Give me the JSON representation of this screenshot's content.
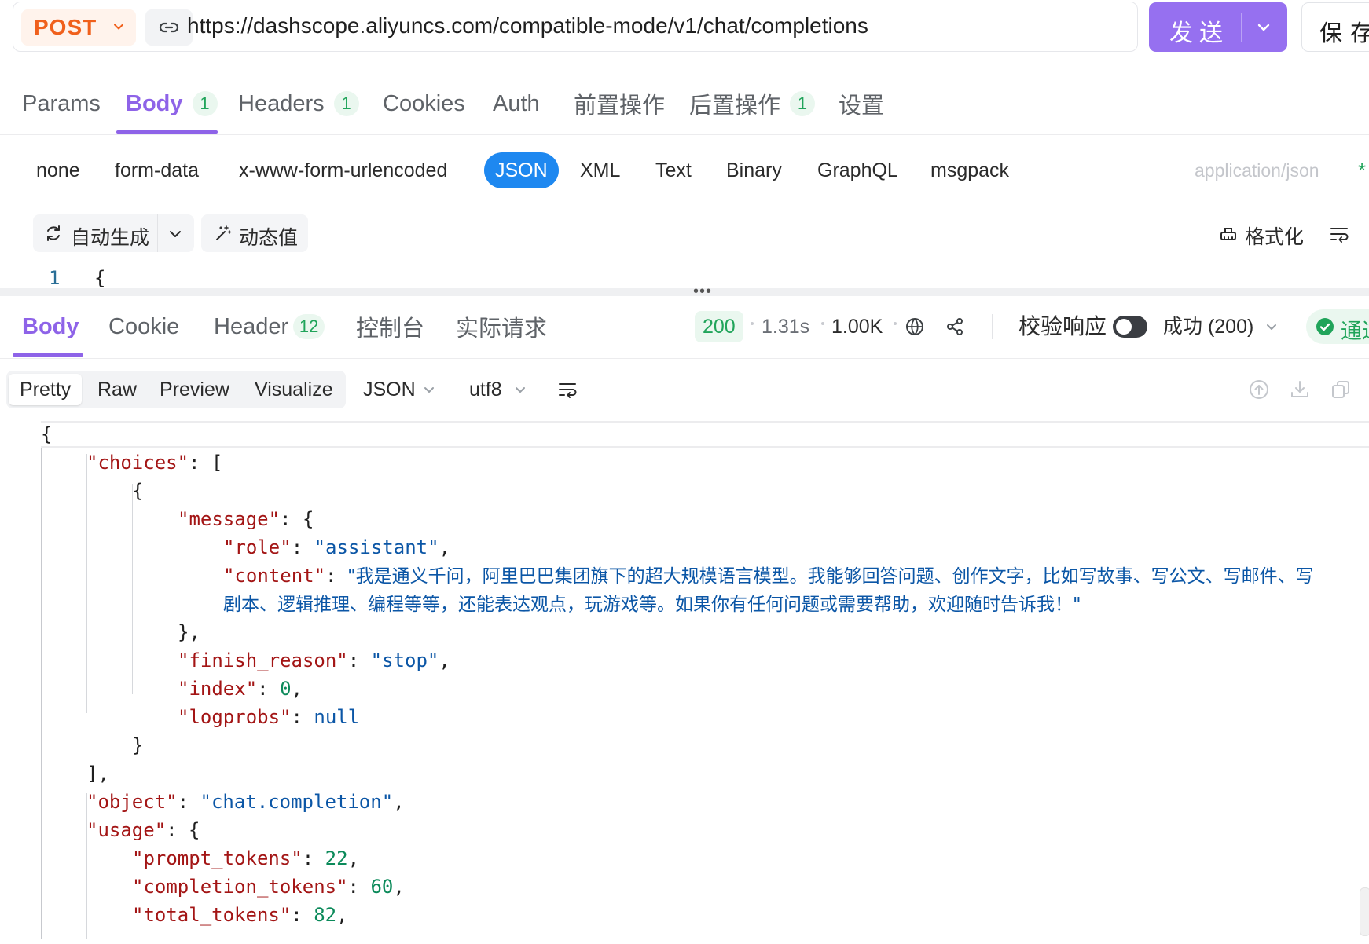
{
  "request": {
    "method": "POST",
    "url": "https://dashscope.aliyuncs.com/compatible-mode/v1/chat/completions",
    "send_label": "发送",
    "save_label": "保存"
  },
  "request_tabs": [
    {
      "label": "Params",
      "count": ""
    },
    {
      "label": "Body",
      "count": "1"
    },
    {
      "label": "Headers",
      "count": "1"
    },
    {
      "label": "Cookies",
      "count": ""
    },
    {
      "label": "Auth",
      "count": ""
    },
    {
      "label": "前置操作",
      "count": ""
    },
    {
      "label": "后置操作",
      "count": "1"
    },
    {
      "label": "设置",
      "count": ""
    }
  ],
  "active_request_tab": "Body",
  "body_types": [
    "none",
    "form-data",
    "x-www-form-urlencoded",
    "JSON",
    "XML",
    "Text",
    "Binary",
    "GraphQL",
    "msgpack"
  ],
  "active_body_type": "JSON",
  "content_type": "application/json",
  "content_type_marker": "*",
  "editor": {
    "auto_generate": "自动生成",
    "dynamic_value": "动态值",
    "format": "格式化",
    "line_number": "1",
    "line_text": "{"
  },
  "response_tabs": [
    {
      "label": "Body",
      "count": ""
    },
    {
      "label": "Cookie",
      "count": ""
    },
    {
      "label": "Header",
      "count": "12"
    },
    {
      "label": "控制台",
      "count": ""
    },
    {
      "label": "实际请求",
      "count": ""
    }
  ],
  "active_response_tab": "Body",
  "response_meta": {
    "status": "200",
    "time": "1.31s",
    "size": "1.00K",
    "validate_label": "校验响应",
    "validate_on": true,
    "success_select": "成功 (200)",
    "pass_label": "通过"
  },
  "view_modes": [
    "Pretty",
    "Raw",
    "Preview",
    "Visualize"
  ],
  "active_view_mode": "Pretty",
  "format_select": "JSON",
  "encoding_select": "utf8",
  "response_body": {
    "choices_key": "\"choices\"",
    "message_key": "\"message\"",
    "role_key": "\"role\"",
    "role_value": "\"assistant\"",
    "content_key": "\"content\"",
    "content_value_line1": "\"我是通义千问，阿里巴巴集团旗下的超大规模语言模型。我能够回答问题、创作文字，比如写故事、写公文、写邮件、写",
    "content_value_line2": "剧本、逻辑推理、编程等等，还能表达观点，玩游戏等。如果你有任何问题或需要帮助，欢迎随时告诉我！\"",
    "finish_reason_key": "\"finish_reason\"",
    "finish_reason_value": "\"stop\"",
    "index_key": "\"index\"",
    "index_value": "0",
    "logprobs_key": "\"logprobs\"",
    "logprobs_value": "null",
    "object_key": "\"object\"",
    "object_value": "\"chat.completion\"",
    "usage_key": "\"usage\"",
    "prompt_tokens_key": "\"prompt_tokens\"",
    "prompt_tokens_value": "22",
    "completion_tokens_key": "\"completion_tokens\"",
    "completion_tokens_value": "60",
    "total_tokens_key": "\"total_tokens\"",
    "total_tokens_value": "82"
  },
  "colors": {
    "accent": "#8e63e8",
    "send_button": "#9670f0",
    "method": "#f0601c",
    "json_active": "#1e88f0",
    "success": "#20a45a"
  }
}
